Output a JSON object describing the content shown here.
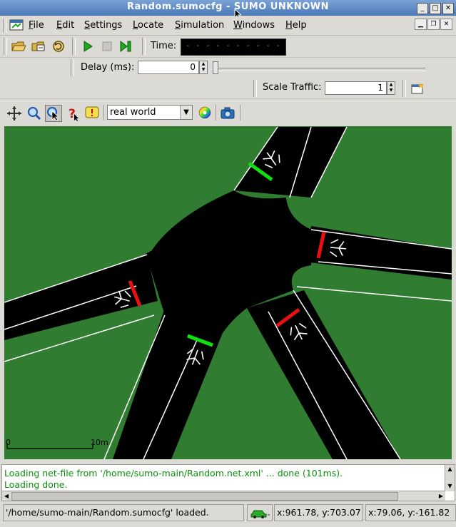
{
  "window": {
    "title": "Random.sumocfg - SUMO UNKNOWN",
    "min_glyph": "_",
    "max_glyph": "□",
    "close_glyph": "✕"
  },
  "menubar": {
    "items": [
      {
        "label": "File",
        "mnemonic": "F"
      },
      {
        "label": "Edit",
        "mnemonic": "E"
      },
      {
        "label": "Settings",
        "mnemonic": "S"
      },
      {
        "label": "Locate",
        "mnemonic": "L"
      },
      {
        "label": "Simulation",
        "mnemonic": "S"
      },
      {
        "label": "Windows",
        "mnemonic": "W"
      },
      {
        "label": "Help",
        "mnemonic": "H"
      }
    ]
  },
  "toolbar": {
    "time_label": "Time:",
    "time_value": "- - - - - - - - - - - - - -",
    "delay_label": "Delay (ms):",
    "delay_value": "0",
    "delay_slider_fraction": 0,
    "scale_label": "Scale Traffic:",
    "scale_value": "1"
  },
  "view_toolbar": {
    "scheme_selected": "real world"
  },
  "view": {
    "colors": {
      "grass": "#307c30",
      "road": "#000000",
      "lane_line": "#ffffff",
      "signal_red": "#e81010",
      "signal_green": "#10e010"
    },
    "scale_start": "0",
    "scale_end": "10m"
  },
  "messages": [
    "Loading net-file from '/home/sumo-main/Random.net.xml' ... done (101ms).",
    "Loading done."
  ],
  "statusbar": {
    "message": "'/home/sumo-main/Random.sumocfg' loaded.",
    "coord_net": "x:961.78, y:703.07",
    "coord_geo": "x:79.06, y:-161.82"
  }
}
